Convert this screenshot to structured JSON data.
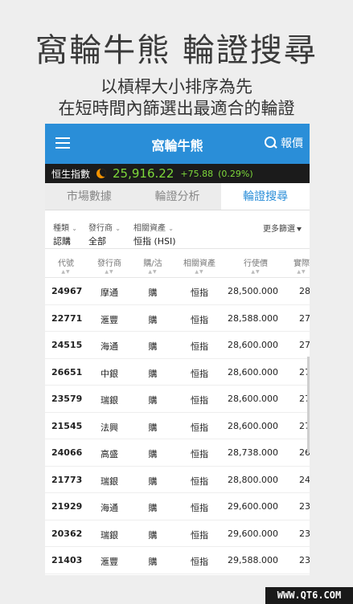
{
  "promo": {
    "title": "窩輪牛熊 輪證搜尋",
    "subtitle_line1": "以槓桿大小排序為先",
    "subtitle_line2": "在短時間內篩選出最適合的輪證"
  },
  "appbar": {
    "title": "窩輪牛熊",
    "report_label": "報價"
  },
  "ticker": {
    "name": "恒生指數",
    "price": "25,916.22",
    "change": "+75.88",
    "percent": "(0.29%)",
    "color_up": "#7dd83a"
  },
  "tabs": [
    {
      "label": "市場數據"
    },
    {
      "label": "輪證分析"
    },
    {
      "label": "輪證搜尋"
    }
  ],
  "filters": {
    "type": {
      "label": "種類",
      "value": "認購"
    },
    "issuer": {
      "label": "發行商",
      "value": "全部"
    },
    "asset": {
      "label": "相關資產",
      "value": "恒指 (HSI)"
    },
    "more_label": "更多篩選"
  },
  "table": {
    "headers": [
      "代號",
      "發行商",
      "購/沽",
      "相關資產",
      "行使價",
      "實際"
    ],
    "rows": [
      [
        "24967",
        "摩通",
        "購",
        "恒指",
        "28,500.000",
        "28"
      ],
      [
        "22771",
        "滙豐",
        "購",
        "恒指",
        "28,588.000",
        "27"
      ],
      [
        "24515",
        "海通",
        "購",
        "恒指",
        "28,600.000",
        "27"
      ],
      [
        "26651",
        "中銀",
        "購",
        "恒指",
        "28,600.000",
        "27"
      ],
      [
        "23579",
        "瑞銀",
        "購",
        "恒指",
        "28,600.000",
        "27"
      ],
      [
        "21545",
        "法興",
        "購",
        "恒指",
        "28,600.000",
        "27"
      ],
      [
        "24066",
        "高盛",
        "購",
        "恒指",
        "28,738.000",
        "26"
      ],
      [
        "21773",
        "瑞銀",
        "購",
        "恒指",
        "28,800.000",
        "24"
      ],
      [
        "21929",
        "海通",
        "購",
        "恒指",
        "29,600.000",
        "23"
      ],
      [
        "20362",
        "瑞銀",
        "購",
        "恒指",
        "29,600.000",
        "23"
      ],
      [
        "21403",
        "滙豐",
        "購",
        "恒指",
        "29,588.000",
        "23"
      ]
    ]
  },
  "watermark": "WWW.QT6.COM",
  "colors": {
    "accent": "#2a8ed8",
    "ticker_bg": "#1b1b1b",
    "moon": "#f39200"
  }
}
